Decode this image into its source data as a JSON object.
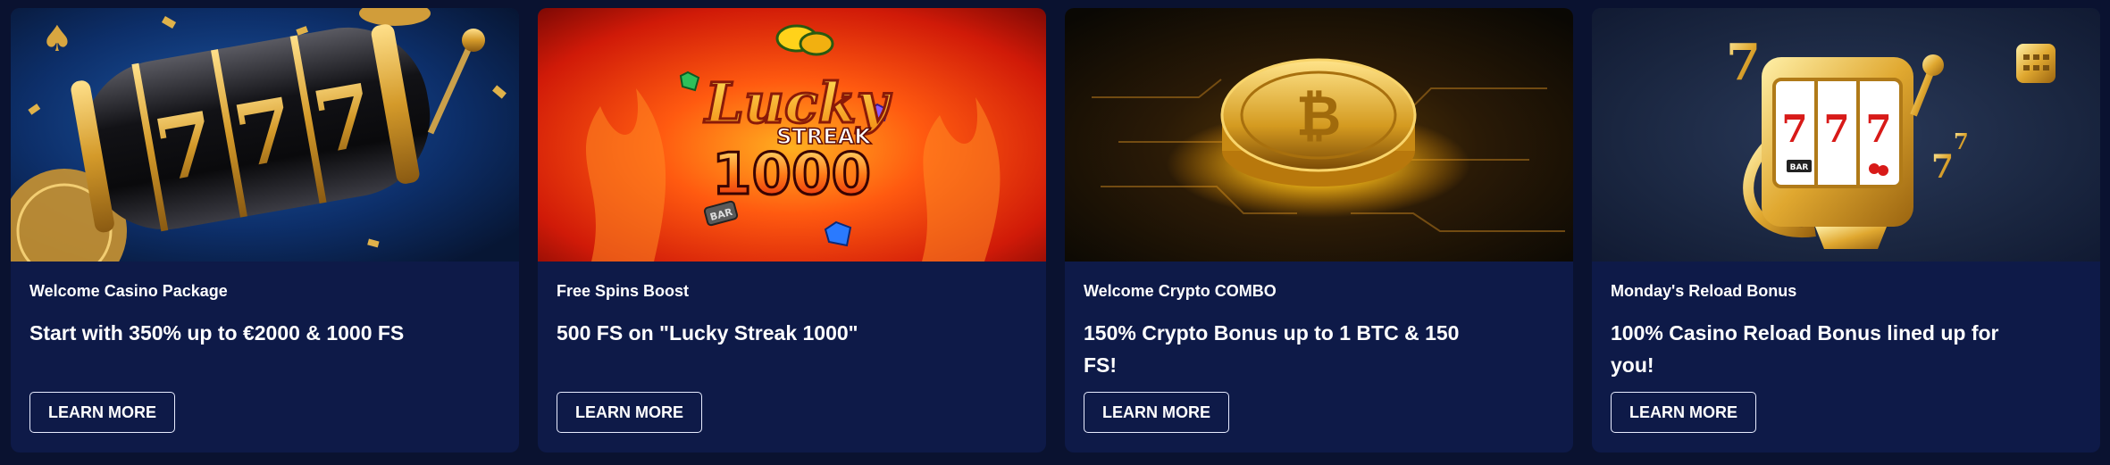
{
  "cards": [
    {
      "category": "Welcome Casino Package",
      "headline": "Start with 350% up to €2000 & 1000 FS",
      "button": "LEARN MORE",
      "image_text": "777"
    },
    {
      "category": "Free Spins Boost",
      "headline": "500 FS on \"Lucky Streak 1000\"",
      "button": "LEARN MORE",
      "image_text": {
        "line1": "Lucky",
        "line2": "STREAK",
        "line3": "1000",
        "badge": "BAR"
      }
    },
    {
      "category": "Welcome Crypto COMBO",
      "headline": "150% Crypto Bonus up to 1 BTC & 150 FS!",
      "button": "LEARN MORE"
    },
    {
      "category": "Monday's Reload Bonus",
      "headline": "100% Casino Reload Bonus lined up for you!",
      "button": "LEARN MORE",
      "image_text": {
        "reel": "777",
        "badge": "BAR"
      }
    }
  ],
  "colors": {
    "page_bg": "#0a1230",
    "card_bg": "#0e1a48",
    "gold": "#e7b53a",
    "fire": "#ff4a12"
  }
}
